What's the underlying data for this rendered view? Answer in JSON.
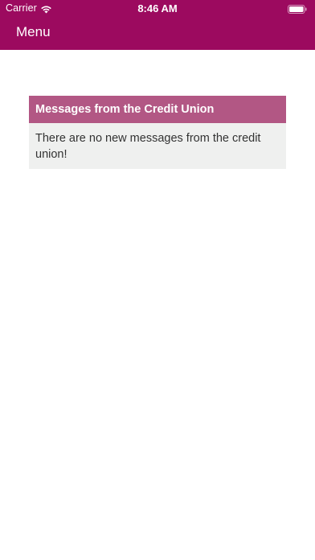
{
  "status_bar": {
    "carrier": "Carrier",
    "time": "8:46 AM",
    "icons": [
      "wifi-icon",
      "battery-icon"
    ]
  },
  "header": {
    "menu_label": "Menu",
    "background_color": "#9c0a5f"
  },
  "messages_card": {
    "title": "Messages from the Credit Union",
    "body": "There are no new messages from the credit union!",
    "header_color": "#b25784",
    "body_background": "#eff0ef"
  }
}
